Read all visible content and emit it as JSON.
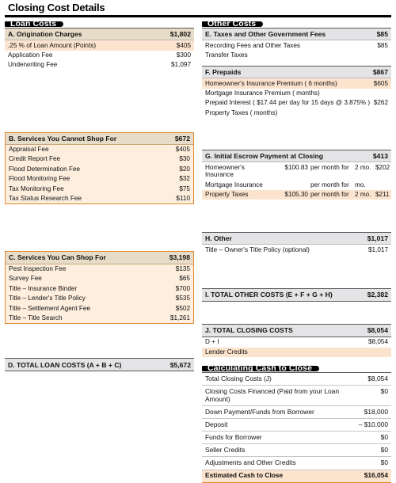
{
  "document": {
    "title": "Closing Cost Details"
  },
  "loan_costs": {
    "tab_label": "Loan Costs",
    "sections": [
      {
        "id": "A",
        "header": "A.  Origination Charges",
        "header_amount": "$1,802",
        "items": [
          {
            "label": ".25 % of Loan Amount (Points)",
            "amount": "$405",
            "highlight": true
          },
          {
            "label": "Application Fee",
            "amount": "$300",
            "highlight": false
          },
          {
            "label": "Underwriting Fee",
            "amount": "$1,097",
            "highlight": false
          }
        ]
      },
      {
        "id": "B",
        "header": "B.  Services You Cannot Shop For",
        "header_amount": "$672",
        "items": [
          {
            "label": "Appraisal Fee",
            "amount": "$405"
          },
          {
            "label": "Credit Report Fee",
            "amount": "$30"
          },
          {
            "label": "Flood Determination Fee",
            "amount": "$20"
          },
          {
            "label": "Flood Monitoring Fee",
            "amount": "$32"
          },
          {
            "label": "Tax Monitoring Fee",
            "amount": "$75"
          },
          {
            "label": "Tax Status Research Fee",
            "amount": "$110"
          }
        ]
      },
      {
        "id": "C",
        "header": "C.  Services You Can Shop For",
        "header_amount": "$3,198",
        "items": [
          {
            "label": "Pest Inspection Fee",
            "amount": "$135"
          },
          {
            "label": "Survey Fee",
            "amount": "$65"
          },
          {
            "label": "Title – Insurance Binder",
            "amount": "$700"
          },
          {
            "label": "Title – Lender's Title Policy",
            "amount": "$535"
          },
          {
            "label": "Title – Settlement Agent Fee",
            "amount": "$502"
          },
          {
            "label": "Title – Title Search",
            "amount": "$1,261"
          }
        ]
      }
    ],
    "total": {
      "label": "D.  TOTAL LOAN COSTS (A + B + C)",
      "amount": "$5,672"
    }
  },
  "other_costs": {
    "tab_label": "Other Costs",
    "section_e": {
      "header": "E.  Taxes and Other Government Fees",
      "header_amount": "$85",
      "items": [
        {
          "label": "Recording Fees and Other Taxes",
          "amount": "$85"
        },
        {
          "label": "Transfer Taxes",
          "amount": ""
        }
      ]
    },
    "section_f": {
      "header": "F.  Prepaids",
      "header_amount": "$867",
      "items": [
        {
          "label": "Homeowner's Insurance Premium (  6    months)",
          "amount": "$605",
          "highlight": true
        },
        {
          "label": "Mortgage Insurance Premium (        months)",
          "amount": "",
          "highlight": false
        },
        {
          "label": "Prepaid Interest  ( $17.44  per day for 15 days @ 3.875% )",
          "amount": "$262",
          "highlight": false
        },
        {
          "label": "Property Taxes (        months)",
          "amount": "",
          "highlight": false
        }
      ]
    },
    "section_g": {
      "header": "G.  Initial Escrow Payment at Closing",
      "header_amount": "$413",
      "rows": [
        {
          "label": "Homeowner's Insurance",
          "rate": "$100.83",
          "per": "per month for",
          "months": "2  mo.",
          "amount": "$202",
          "highlight": false
        },
        {
          "label": "Mortgage Insurance",
          "rate": "",
          "per": "per month for",
          "months": "mo.",
          "amount": "",
          "highlight": false
        },
        {
          "label": "Property Taxes",
          "rate": "$105.30",
          "per": "per month for",
          "months": "2  mo.",
          "amount": "$211",
          "highlight": true
        }
      ]
    },
    "section_h": {
      "header": "H. Other",
      "header_amount": "$1,017",
      "items": [
        {
          "label": "Title – Owner's Title Policy (optional)",
          "amount": "$1,017"
        }
      ]
    },
    "total_i": {
      "label": "I.  TOTAL OTHER COSTS (E + F + G + H)",
      "amount": "$2,382"
    },
    "section_j": {
      "header": "J.  TOTAL CLOSING COSTS",
      "header_amount": "$8,054",
      "items": [
        {
          "label": "D + I",
          "amount": "$8,054",
          "highlight": false
        },
        {
          "label": "Lender Credits",
          "amount": "",
          "highlight": true
        }
      ]
    }
  },
  "cash_to_close": {
    "tab_label": "Calculating Cash to Close",
    "rows": [
      {
        "label": "Total Closing Costs (J)",
        "amount": "$8,054"
      },
      {
        "label": "Closing Costs Financed (Paid from your Loan Amount)",
        "amount": "$0"
      },
      {
        "label": "Down Payment/Funds from Borrower",
        "amount": "$18,000"
      },
      {
        "label": "Deposit",
        "amount": "– $10,000"
      },
      {
        "label": "Funds for Borrower",
        "amount": "$0"
      },
      {
        "label": "Seller Credits",
        "amount": "$0"
      },
      {
        "label": "Adjustments and Other Credits",
        "amount": "$0"
      }
    ],
    "final": {
      "label": "Estimated Cash to Close",
      "amount": "$16,054"
    }
  },
  "colors": {
    "tab_background": "#000000",
    "section_header_tan": "#e6dcc8",
    "section_header_gray": "#e4e4e6",
    "highlight_peach": "#fbe3cd",
    "box_border_orange": "#e08a2e"
  }
}
